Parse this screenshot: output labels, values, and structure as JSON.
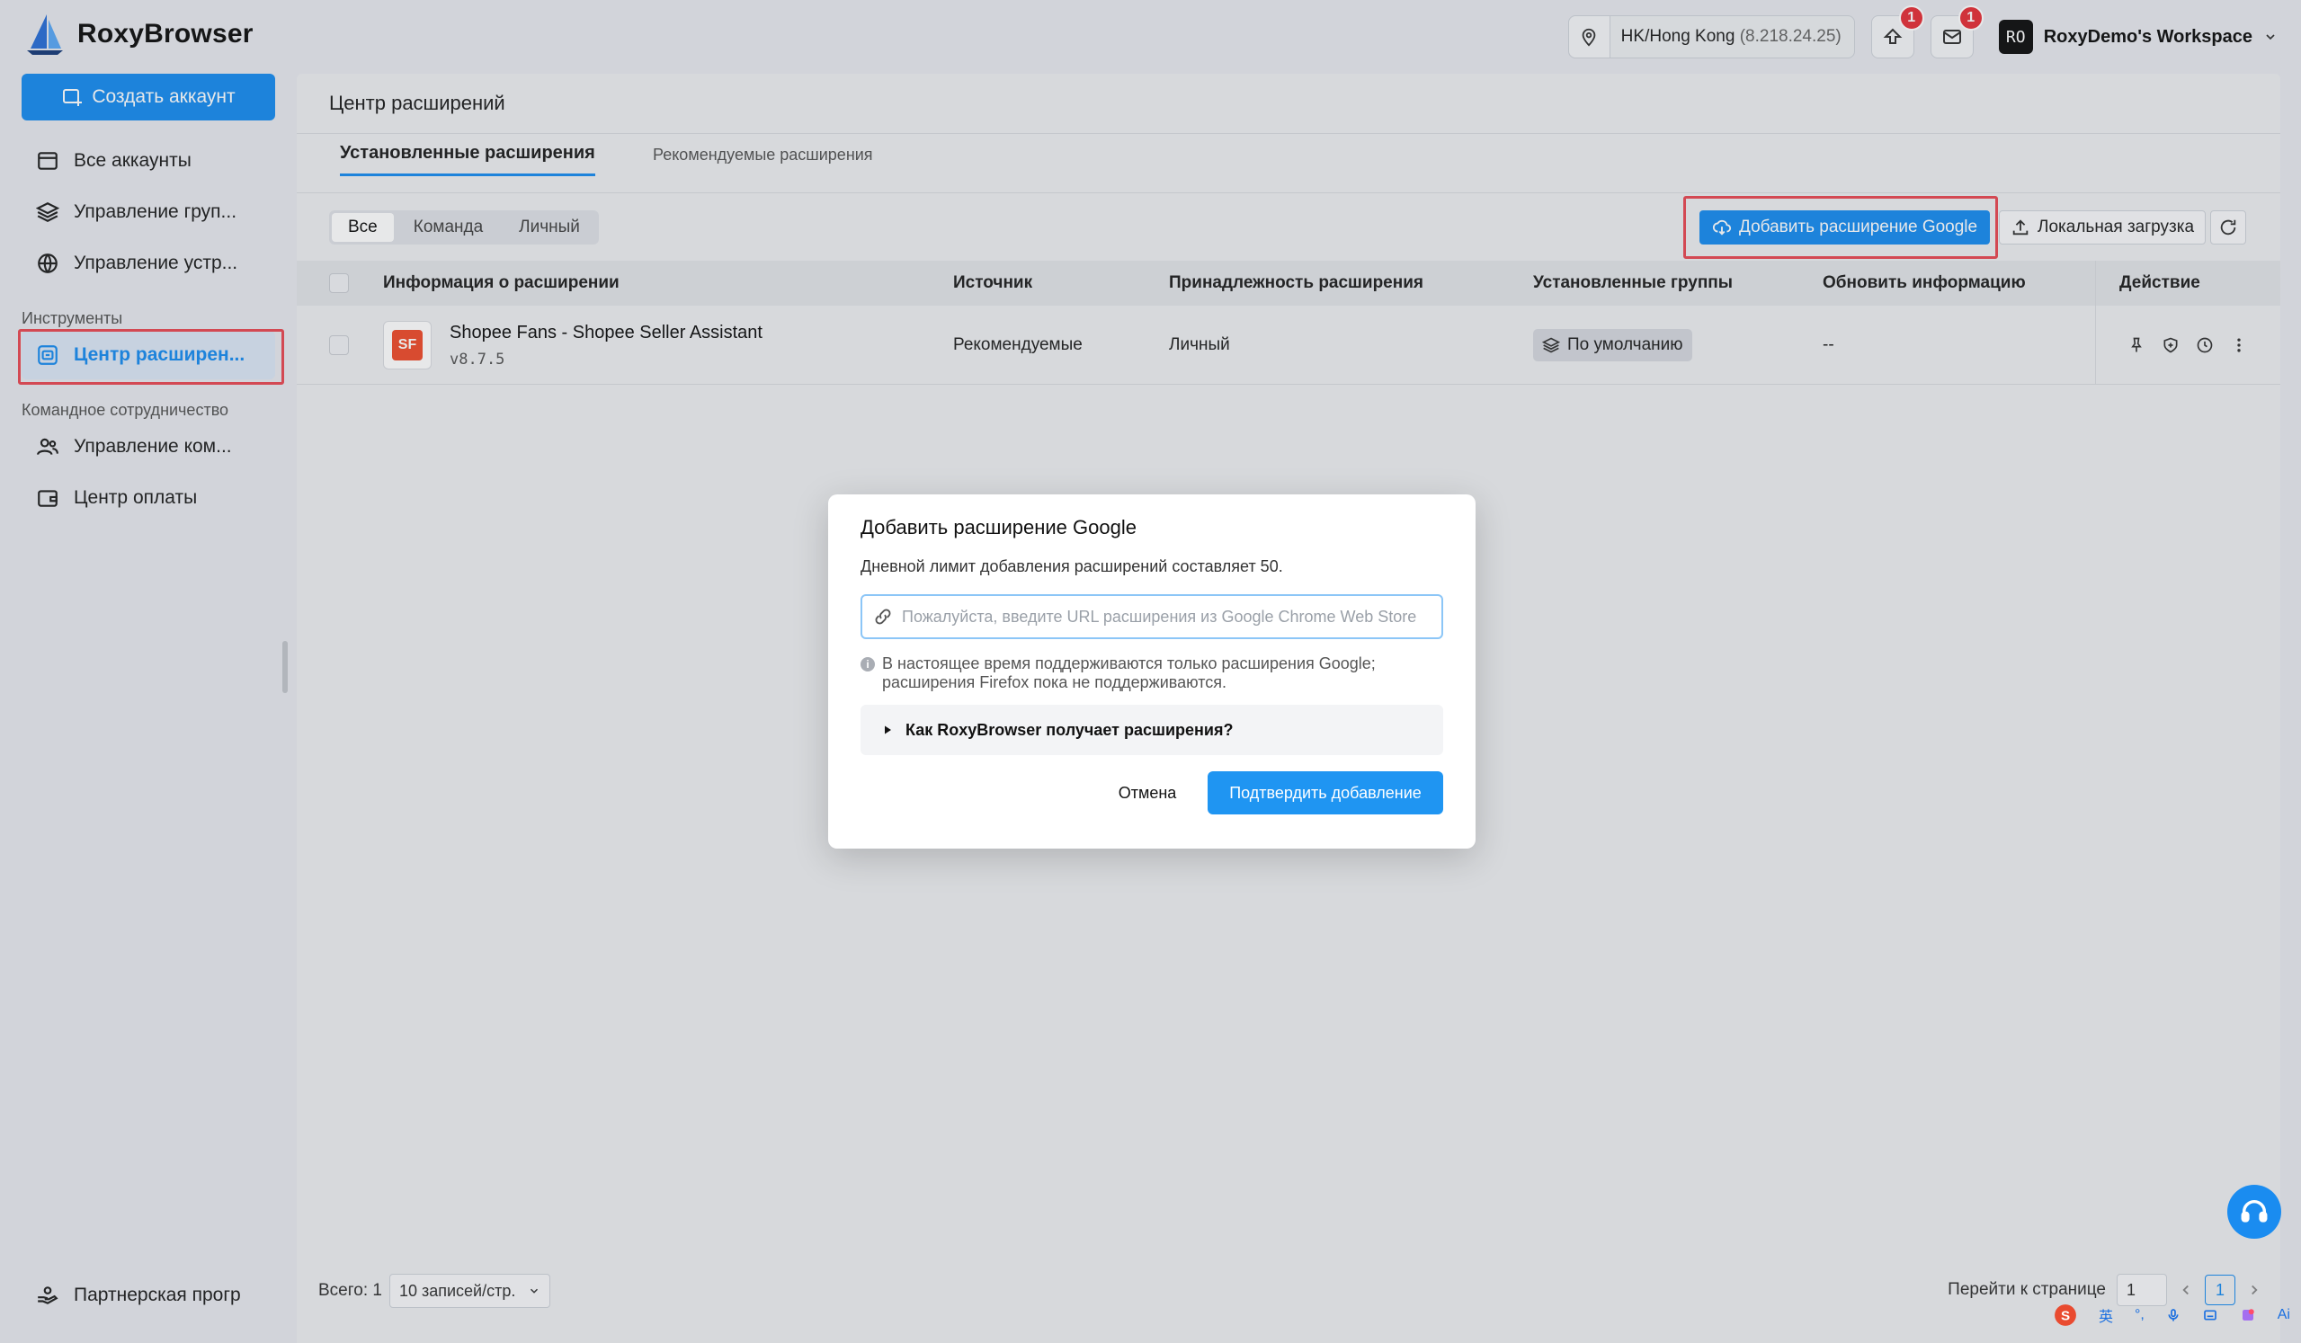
{
  "app": {
    "name": "RoxyBrowser"
  },
  "topbar": {
    "location": "HK/Hong Kong",
    "ip": "(8.218.24.25)",
    "update_badge": "1",
    "mail_badge": "1",
    "workspace_avatar": "RO",
    "workspace_name": "RoxyDemo's Workspace"
  },
  "sidebar": {
    "create_label": "Создать аккаунт",
    "items": [
      {
        "label": "Все аккаунты",
        "icon": "browser-window-icon"
      },
      {
        "label": "Управление груп...",
        "icon": "layers-icon"
      },
      {
        "label": "Управление устр...",
        "icon": "globe-icon"
      }
    ],
    "section_tools": "Инструменты",
    "tools_item": "Центр расширен...",
    "section_team": "Командное сотрудничество",
    "team_items": [
      {
        "label": "Управление ком...",
        "icon": "users-icon"
      },
      {
        "label": "Центр оплаты",
        "icon": "wallet-icon"
      }
    ],
    "partner": "Партнерская прогр"
  },
  "main": {
    "title": "Центр расширений",
    "tabs": [
      "Установленные расширения",
      "Рекомендуемые расширения"
    ],
    "filters": [
      "Все",
      "Команда",
      "Личный"
    ],
    "add_google_label": "Добавить расширение Google",
    "local_upload_label": "Локальная загрузка",
    "columns": [
      "Информация о расширении",
      "Источник",
      "Принадлежность расширения",
      "Установленные группы",
      "Обновить информацию",
      "Действие"
    ],
    "rows": [
      {
        "name": "Shopee Fans - Shopee Seller Assistant",
        "version": "v8.7.5",
        "icon_text": "SF",
        "source": "Рекомендуемые",
        "ownership": "Личный",
        "group": "По умолчанию",
        "update": "--"
      }
    ],
    "footer": {
      "total": "Всего: 1",
      "page_size": "10 записей/стр.",
      "goto": "Перейти к странице",
      "goto_value": "1",
      "current_page": "1"
    }
  },
  "modal": {
    "title": "Добавить расширение Google",
    "description": "Дневной лимит добавления расширений составляет 50.",
    "placeholder": "Пожалуйста, введите URL расширения из Google Chrome Web Store",
    "note_line1": "В настоящее время поддерживаются только расширения Google;",
    "note_line2": "расширения Firefox пока не поддерживаются.",
    "collapse_label": "Как RoxyBrowser получает расширения?",
    "cancel": "Отмена",
    "confirm": "Подтвердить добавление"
  },
  "tray": {
    "ime_char": "英",
    "punct": "°,",
    "ai": "Ai"
  },
  "colors": {
    "accent": "#1a8cf0",
    "highlight": "#e94b55",
    "badge": "#e5323a"
  }
}
